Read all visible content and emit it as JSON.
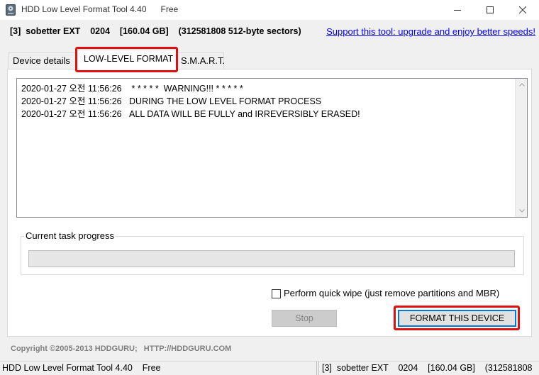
{
  "window": {
    "title": "HDD Low Level Format Tool 4.40",
    "edition": "Free",
    "controls": [
      "minimize-icon",
      "maximize-icon",
      "close-icon"
    ]
  },
  "infobar": {
    "device_info": "[3]  sobetter EXT    0204    [160.04 GB]    (312581808 512-byte sectors)",
    "support_link": "Support this tool: upgrade and enjoy better speeds!"
  },
  "tabs": [
    {
      "label": "Device details",
      "active": false
    },
    {
      "label": "LOW-LEVEL FORMAT",
      "active": true
    },
    {
      "label": "S.M.A.R.T.",
      "active": false
    }
  ],
  "log": [
    "2020-01-27 오전 11:56:26    * * * * *  WARNING!!! * * * * *",
    "2020-01-27 오전 11:56:26   DURING THE LOW LEVEL FORMAT PROCESS",
    "2020-01-27 오전 11:56:26   ALL DATA WILL BE FULLY and IRREVERSIBLY ERASED!"
  ],
  "progress": {
    "label": "Current task progress",
    "value": 0
  },
  "quick_wipe": {
    "label": "Perform quick wipe (just remove partitions and MBR)",
    "checked": false
  },
  "buttons": {
    "stop": "Stop",
    "stop_enabled": false,
    "format": "FORMAT THIS DEVICE"
  },
  "copyright": "Copyright ©2005-2013 HDDGURU;   HTTP://HDDGURU.COM",
  "statusbar": {
    "left": "HDD Low Level Format Tool 4.40    Free",
    "right": "[3]  sobetter EXT    0204    [160.04 GB]    (312581808"
  },
  "colors": {
    "highlight": "#e01010",
    "link": "#0000ff",
    "focus": "#0078d7"
  }
}
